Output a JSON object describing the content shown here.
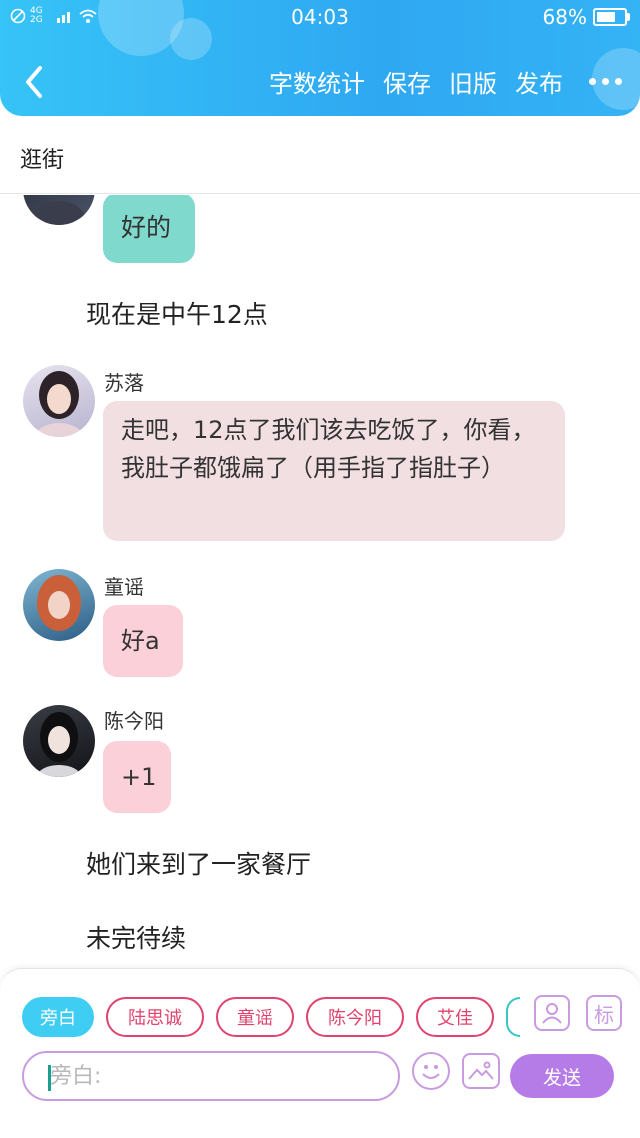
{
  "status_bar": {
    "network": "4G 2G",
    "time": "04:03",
    "battery": "68%",
    "battery_level": 0.68
  },
  "header": {
    "actions": [
      "字数统计",
      "保存",
      "旧版",
      "发布"
    ]
  },
  "titlebar": {
    "title": "逛街"
  },
  "chat": {
    "partial_message": {
      "text": "好的",
      "bubble_color": "#7fd9cd"
    },
    "narration_1": "现在是中午12点",
    "messages": [
      {
        "speaker": "苏落",
        "text": "走吧，12点了我们该去吃饭了，你看，我肚子都饿扁了（用手指了指肚子）",
        "bubble_color": "#f2dfe1"
      },
      {
        "speaker": "童谣",
        "text": "好a",
        "bubble_color": "#fbd0d8"
      },
      {
        "speaker": "陈今阳",
        "text": "+1",
        "bubble_color": "#fbd0d8"
      }
    ],
    "narration_2": "她们来到了一家餐厅",
    "narration_3": "未完待续"
  },
  "input_panel": {
    "chips": [
      {
        "label": "旁白",
        "active": true
      },
      {
        "label": "陆思诚",
        "active": false
      },
      {
        "label": "童谣",
        "active": false
      },
      {
        "label": "陈今阳",
        "active": false
      },
      {
        "label": "艾佳",
        "active": false
      }
    ],
    "character_icon": "person-card-icon",
    "tag_icon_label": "标",
    "input_placeholder": "旁白:",
    "emoji_icon": "smiley-icon",
    "image_icon": "image-icon",
    "send_label": "发送"
  },
  "colors": {
    "header": "#2fa8f2",
    "accent_purple": "#b57be6",
    "chip_border": "#e0436e",
    "chip_active": "#3fcdf3"
  }
}
